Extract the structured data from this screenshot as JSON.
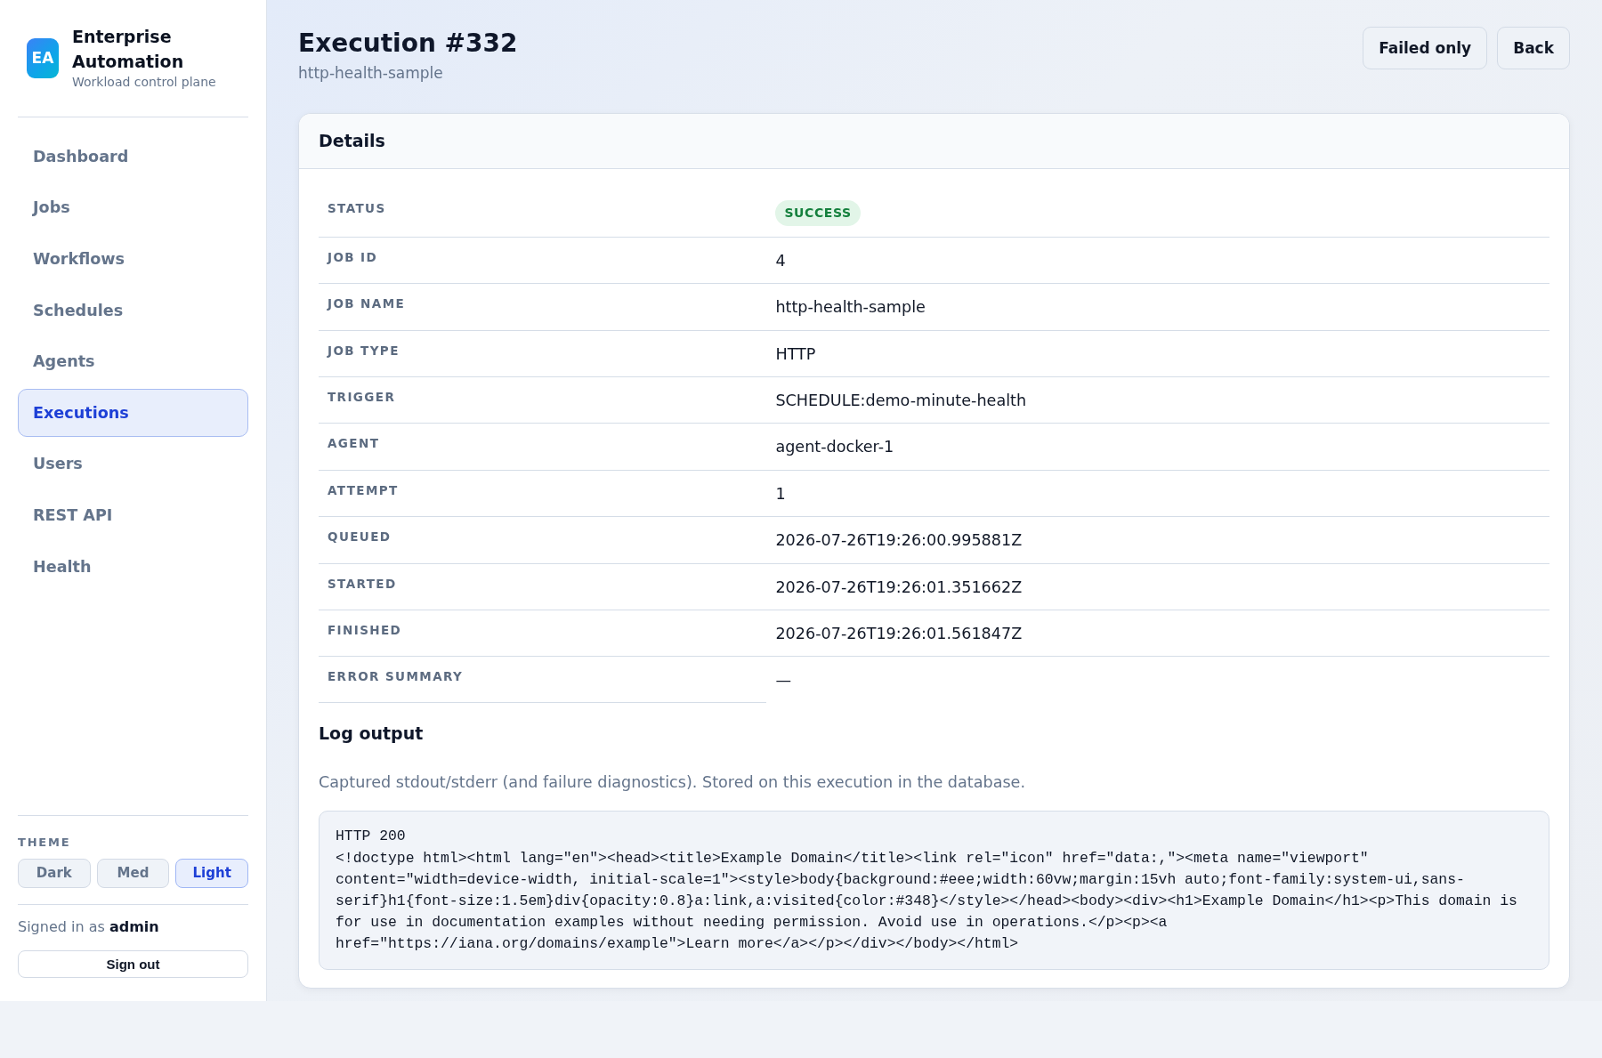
{
  "sidebar": {
    "brand": {
      "logo": "EA",
      "title": "Enterprise Automation",
      "subtitle": "Workload control plane"
    },
    "nav_items": [
      {
        "label": "Dashboard",
        "selected": false
      },
      {
        "label": "Jobs",
        "selected": false
      },
      {
        "label": "Workflows",
        "selected": false
      },
      {
        "label": "Schedules",
        "selected": false
      },
      {
        "label": "Agents",
        "selected": false
      },
      {
        "label": "Executions",
        "selected": true
      },
      {
        "label": "Users",
        "selected": false
      },
      {
        "label": "REST API",
        "selected": false
      },
      {
        "label": "Health",
        "selected": false
      }
    ],
    "theme": {
      "label": "THEME",
      "options": [
        {
          "label": "Dark",
          "selected": false
        },
        {
          "label": "Med",
          "selected": false
        },
        {
          "label": "Light",
          "selected": true
        }
      ]
    },
    "signed_in": "Signed in as **admin**",
    "sign_out_button": "Sign out"
  },
  "header": {
    "title": "Execution #332",
    "subtitle": "http-health-sample",
    "buttons": [
      "Failed only",
      "Back"
    ]
  },
  "details": {
    "title": "Details",
    "rows": [
      {
        "label": "STATUS",
        "value": "SUCCESS",
        "kind": "badge"
      },
      {
        "label": "JOB ID",
        "value": "4",
        "kind": "text"
      },
      {
        "label": "JOB NAME",
        "value": "http-health-sample",
        "kind": "text"
      },
      {
        "label": "JOB TYPE",
        "value": "HTTP",
        "kind": "text"
      },
      {
        "label": "TRIGGER",
        "value": "SCHEDULE:demo-minute-health",
        "kind": "text"
      },
      {
        "label": "AGENT",
        "value": "agent-docker-1",
        "kind": "text"
      },
      {
        "label": "ATTEMPT",
        "value": "1",
        "kind": "text"
      },
      {
        "label": "QUEUED",
        "value": "2026-07-26T19:26:00.995881Z",
        "kind": "text"
      },
      {
        "label": "STARTED",
        "value": "2026-07-26T19:26:01.351662Z",
        "kind": "text"
      },
      {
        "label": "FINISHED",
        "value": "2026-07-26T19:26:01.561847Z",
        "kind": "text"
      },
      {
        "label": "ERROR SUMMARY",
        "value": "—",
        "kind": "text"
      }
    ]
  },
  "log": {
    "title": "Log output",
    "description": "Captured stdout/stderr (and failure diagnostics). Stored on this execution in the database.",
    "output": "HTTP 200\n<!doctype html><html lang=\"en\"><head><title>Example Domain</title><link rel=\"icon\" href=\"data:,\"><meta name=\"viewport\" content=\"width=device-width, initial-scale=1\"><style>body{background:#eee;width:60vw;margin:15vh auto;font-family:system-ui,sans-serif}h1{font-size:1.5em}div{opacity:0.8}a:link,a:visited{color:#348}</style></head><body><div><h1>Example Domain</h1><p>This domain is for use in documentation examples without needing permission. Avoid use in operations.</p><p><a href=\"https://iana.org/domains/example\">Learn more</a></p></div></body></html>"
  }
}
